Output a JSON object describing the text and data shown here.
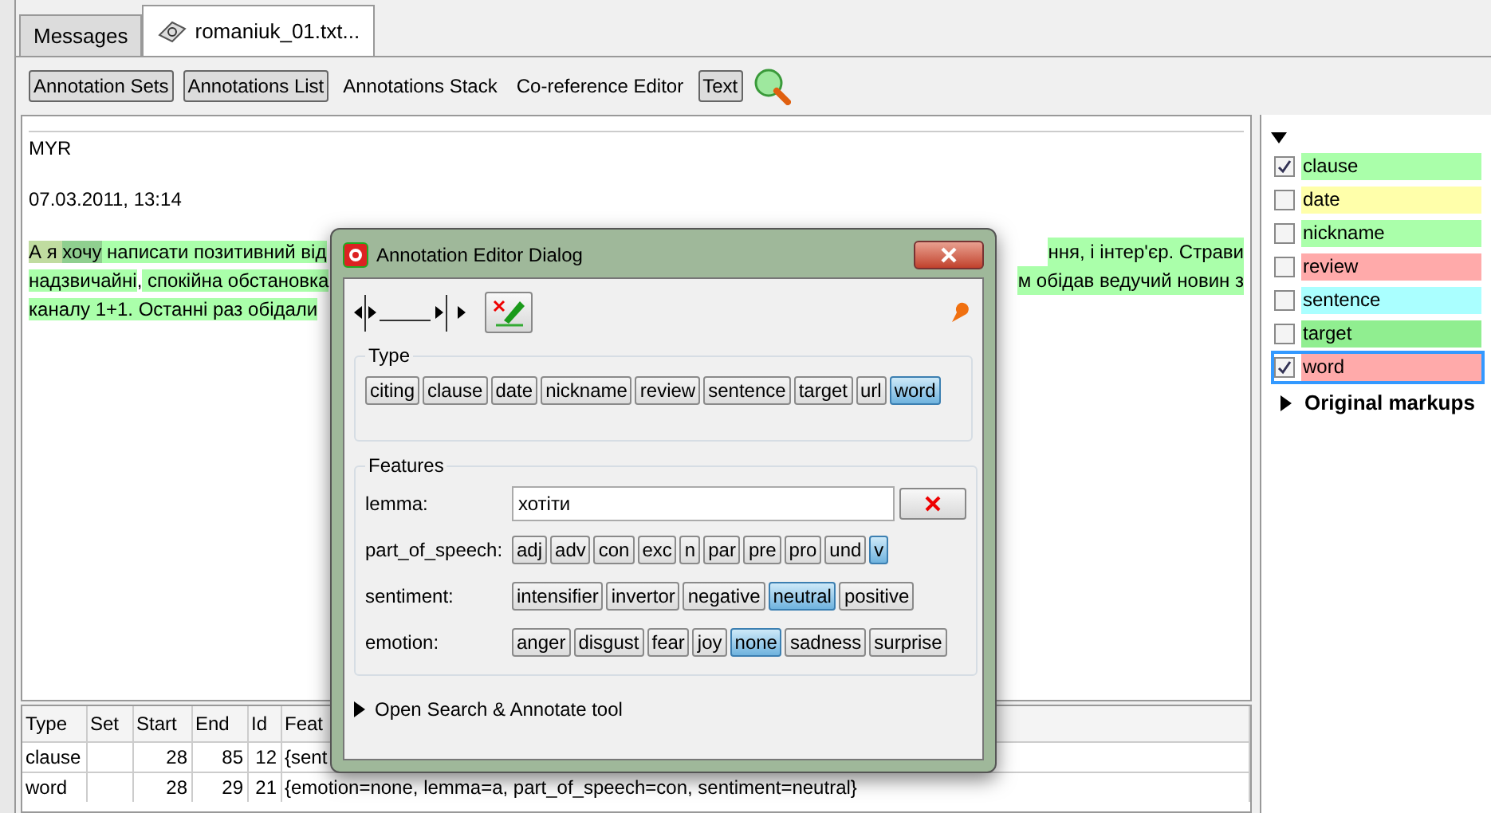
{
  "tabs": [
    {
      "label": "Messages",
      "selected": false,
      "icon": false
    },
    {
      "label": "romaniuk_01.txt...",
      "selected": true,
      "icon": true
    }
  ],
  "toolbar": [
    {
      "label": "Annotation Sets",
      "selected": true
    },
    {
      "label": "Annotations List",
      "selected": true
    },
    {
      "label": "Annotations Stack",
      "selected": false
    },
    {
      "label": "Co-reference Editor",
      "selected": false
    },
    {
      "label": "Text",
      "selected": true
    }
  ],
  "document": {
    "header": [
      "MYR",
      "07.03.2011, 13:14"
    ],
    "lines": [
      {
        "left": [
          {
            "text": "А я ",
            "color": "#c0dca0"
          },
          {
            "text": "хочу",
            "color": "#8fcf8f"
          },
          {
            "text": " написати позитивний від",
            "color": "#aaffaa"
          }
        ],
        "right": "ння, і інтер'єр. Страви"
      },
      {
        "left": [
          {
            "text": "надзвичайні",
            "color": "#aaffaa"
          },
          {
            "text": ","
          },
          {
            "text": " спокійна обстановка",
            "color": "#aaffaa"
          }
        ],
        "right": "м обідав ведучий новин з"
      },
      {
        "left": [
          {
            "text": "каналу 1+1. Останні раз обідали",
            "color": "#aaffaa"
          }
        ]
      }
    ]
  },
  "table": {
    "columns": [
      "Type",
      "Set",
      "Start",
      "End",
      "Id",
      "Feat"
    ],
    "rows": [
      [
        "clause",
        "",
        "28",
        "85",
        "12",
        "{sent"
      ],
      [
        "word",
        "",
        "28",
        "29",
        "21",
        "{emotion=none, lemma=a, part_of_speech=con, sentiment=neutral}"
      ]
    ]
  },
  "annotation_types": [
    {
      "name": "clause",
      "checked": true,
      "selected": false,
      "color": "#aaffaa"
    },
    {
      "name": "date",
      "checked": false,
      "selected": false,
      "color": "#ffffaa"
    },
    {
      "name": "nickname",
      "checked": false,
      "selected": false,
      "color": "#aaffaa"
    },
    {
      "name": "review",
      "checked": false,
      "selected": false,
      "color": "#ffaaaa"
    },
    {
      "name": "sentence",
      "checked": false,
      "selected": false,
      "color": "#aaffff"
    },
    {
      "name": "target",
      "checked": false,
      "selected": false,
      "color": "#90ee90"
    },
    {
      "name": "word",
      "checked": true,
      "selected": true,
      "color": "#ffaaaa"
    }
  ],
  "original_markups": {
    "label": "Original markups",
    "expanded": false
  },
  "dialog": {
    "title": "Annotation Editor Dialog",
    "type_label": "Type",
    "types": [
      {
        "label": "citing",
        "selected": false
      },
      {
        "label": "clause",
        "selected": false
      },
      {
        "label": "date",
        "selected": false
      },
      {
        "label": "nickname",
        "selected": false
      },
      {
        "label": "review",
        "selected": false
      },
      {
        "label": "sentence",
        "selected": false
      },
      {
        "label": "target",
        "selected": false
      },
      {
        "label": "url",
        "selected": false
      },
      {
        "label": "word",
        "selected": true
      }
    ],
    "features_label": "Features",
    "features": [
      {
        "kind": "text",
        "name": "lemma:",
        "value": "хотіти"
      },
      {
        "kind": "choices",
        "name": "part_of_speech:",
        "options": [
          {
            "label": "adj",
            "selected": false
          },
          {
            "label": "adv",
            "selected": false
          },
          {
            "label": "con",
            "selected": false
          },
          {
            "label": "exc",
            "selected": false
          },
          {
            "label": "n",
            "selected": false
          },
          {
            "label": "par",
            "selected": false
          },
          {
            "label": "pre",
            "selected": false
          },
          {
            "label": "pro",
            "selected": false
          },
          {
            "label": "und",
            "selected": false
          },
          {
            "label": "v",
            "selected": true
          }
        ]
      },
      {
        "kind": "choices",
        "name": "sentiment:",
        "options": [
          {
            "label": "intensifier",
            "selected": false
          },
          {
            "label": "invertor",
            "selected": false
          },
          {
            "label": "negative",
            "selected": false
          },
          {
            "label": "neutral",
            "selected": true
          },
          {
            "label": "positive",
            "selected": false
          }
        ]
      },
      {
        "kind": "choices",
        "name": "emotion:",
        "options": [
          {
            "label": "anger",
            "selected": false
          },
          {
            "label": "disgust",
            "selected": false
          },
          {
            "label": "fear",
            "selected": false
          },
          {
            "label": "joy",
            "selected": false
          },
          {
            "label": "none",
            "selected": true
          },
          {
            "label": "sadness",
            "selected": false
          },
          {
            "label": "surprise",
            "selected": false
          }
        ]
      }
    ],
    "search_tool": {
      "label": "Open Search & Annotate tool",
      "expanded": false
    }
  }
}
